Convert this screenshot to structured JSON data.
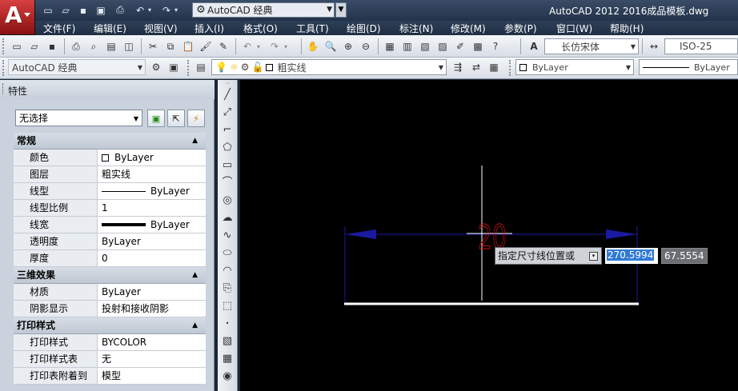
{
  "app": {
    "logo_letter": "A",
    "title": "AutoCAD 2012    2016成品模板.dwg",
    "workspace": "AutoCAD 经典"
  },
  "menu": [
    "文件(F)",
    "编辑(E)",
    "视图(V)",
    "插入(I)",
    "格式(O)",
    "工具(T)",
    "绘图(D)",
    "标注(N)",
    "修改(M)",
    "参数(P)",
    "窗口(W)",
    "帮助(H)"
  ],
  "toolbar": {
    "text_style": "长仿宋体",
    "dim_style": "ISO-25",
    "workspace": "AutoCAD 经典",
    "layer": "粗实线",
    "color": "ByLayer",
    "linetype": "ByLayer"
  },
  "properties": {
    "title": "特性",
    "selection": "无选择",
    "sections": [
      {
        "name": "常规",
        "rows": [
          {
            "key": "颜色",
            "value": "ByLayer",
            "swatch": "box"
          },
          {
            "key": "图层",
            "value": "粗实线"
          },
          {
            "key": "线型",
            "value": "ByLayer",
            "swatch": "line"
          },
          {
            "key": "线型比例",
            "value": "1"
          },
          {
            "key": "线宽",
            "value": "ByLayer",
            "swatch": "thick"
          },
          {
            "key": "透明度",
            "value": "ByLayer"
          },
          {
            "key": "厚度",
            "value": "0"
          }
        ]
      },
      {
        "name": "三维效果",
        "rows": [
          {
            "key": "材质",
            "value": "ByLayer"
          },
          {
            "key": "阴影显示",
            "value": "投射和接收阴影"
          }
        ]
      },
      {
        "name": "打印样式",
        "rows": [
          {
            "key": "打印样式",
            "value": "BYCOLOR"
          },
          {
            "key": "打印样式表",
            "value": "无"
          },
          {
            "key": "打印表附着到",
            "value": "模型"
          }
        ]
      }
    ]
  },
  "canvas": {
    "prompt": "指定尺寸线位置或",
    "coord_x": "270.5994",
    "coord_y": "67.5554",
    "dim_text": "20",
    "colors": {
      "dimension": "#1a1aa0",
      "text": "#cc1111",
      "crosshair": "#ffffff",
      "background": "#000000"
    }
  }
}
